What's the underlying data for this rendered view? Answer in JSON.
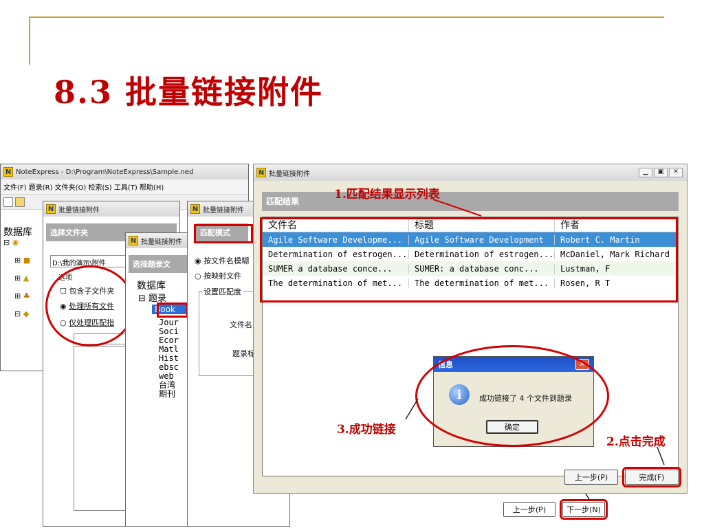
{
  "slide": {
    "title": "8.3 批量链接附件"
  },
  "main_window": {
    "title": "NoteExpress - D:\\Program\\NoteExpress\\Sample.ned",
    "menu": "文件(F)  题录(R)  文件夹(O)  检索(S)  工具(T)  帮助(H)",
    "sidebar_label": "数据库"
  },
  "dialog1": {
    "title": "批量链接附件",
    "section": "选择文件夹",
    "path": "D:\\我的演示\\附件",
    "options_label": "选项",
    "opt_include_sub": "包含子文件夹",
    "opt_process_all": "处理所有文件",
    "opt_process_match": "仅处理匹配指"
  },
  "dialog2": {
    "title": "批量链接附件",
    "section": "选择题录文",
    "tree_root": "数据库",
    "tree_items": [
      "题录",
      "Book",
      "Jour",
      "Soci",
      "Ecor",
      "Matl",
      "Hist",
      "ebsc",
      "web",
      "台湾",
      "期刊"
    ]
  },
  "dialog3": {
    "title": "批量链接附件",
    "section": "匹配模式",
    "opt1": "按文件名模糊",
    "opt2": "按映射文件",
    "group_label": "设置匹配度",
    "label_file": "文件名",
    "label_record": "题录标"
  },
  "dialog4": {
    "title": "批量链接附件",
    "section": "匹配结果",
    "columns": [
      "文件名",
      "标题",
      "作者"
    ],
    "rows": [
      [
        "Agile Software Developme...",
        "Agile Software Development",
        "Robert C. Martin"
      ],
      [
        "Determination of estrogen...",
        "Determination of estrogen...",
        "McDaniel, Mark Richard"
      ],
      [
        "SUMER a database conce...",
        "SUMER: a database conc...",
        "Lustman, F"
      ],
      [
        "The determination of met...",
        "The determination of met...",
        "Rosen, R T"
      ]
    ],
    "btn_prev": "上一步(P)",
    "btn_finish": "完成(F)"
  },
  "message_box": {
    "title": "信息",
    "text": "成功链接了 4 个文件到题录",
    "ok": "确定"
  },
  "behind_buttons": {
    "prev": "上一步(P)",
    "next": "下一步(N)"
  },
  "annotations": {
    "a1": "1.匹配结果显示列表",
    "a2": "2.点击完成",
    "a3": "3.成功链接"
  },
  "colors": {
    "accent_red": "#d40000",
    "selection_blue": "#3b8fd6",
    "frame_gold": "#c8a22a"
  }
}
